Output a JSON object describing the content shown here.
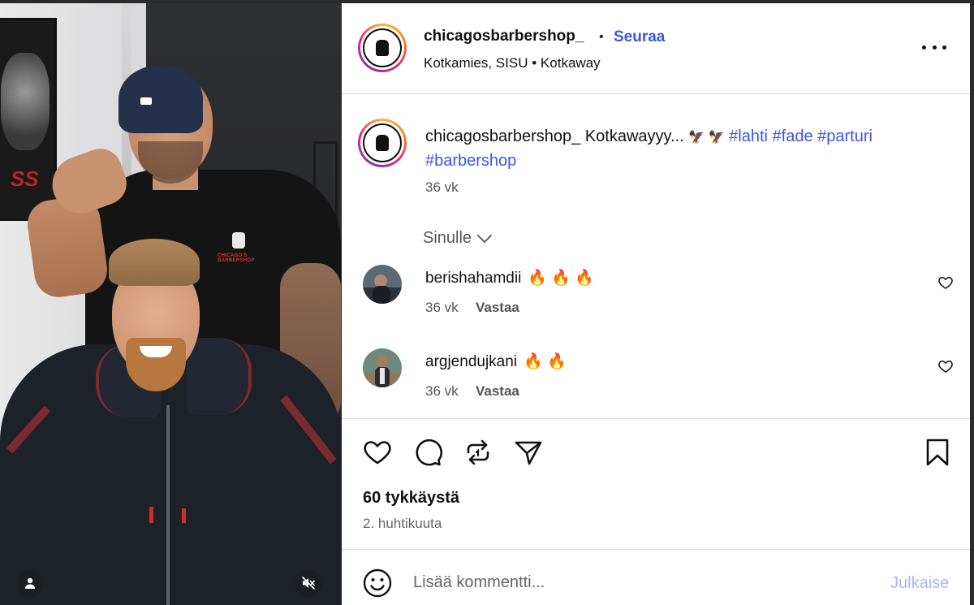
{
  "post": {
    "username": "chicagosbarbershop_",
    "dot": "•",
    "follow_label": "Seuraa",
    "location_primary": "Kotkamies, SISU",
    "location_dot": "•",
    "location_secondary": "Kotkaway",
    "more_icon": "more-horizontal-icon"
  },
  "caption": {
    "username": "chicagosbarbershop_",
    "text": "Kotkawayyy...",
    "emojis": "🦅 🦅",
    "hashtags": [
      "#lahti",
      "#fade",
      "#parturi",
      "#barbershop"
    ],
    "time": "36 vk"
  },
  "filter": {
    "label": "Sinulle",
    "icon": "chevron-down-icon"
  },
  "comments": [
    {
      "username": "berishahamdii",
      "text": "🔥 🔥 🔥",
      "time": "36 vk",
      "reply_label": "Vastaa"
    },
    {
      "username": "argjendujkani",
      "text": "🔥 🔥",
      "time": "36 vk",
      "reply_label": "Vastaa"
    }
  ],
  "actions": {
    "like_icon": "heart-icon",
    "comment_icon": "comment-bubble-icon",
    "repost_icon": "repost-icon",
    "share_icon": "send-icon",
    "save_icon": "bookmark-icon"
  },
  "likes": "60 tykkäystä",
  "date": "2. huhtikuuta",
  "comment_bar": {
    "placeholder": "Lisää kommentti...",
    "post_label": "Julkaise"
  },
  "colors": {
    "link_blue": "#3b55e6",
    "post_disabled": "#a8b8f0"
  }
}
